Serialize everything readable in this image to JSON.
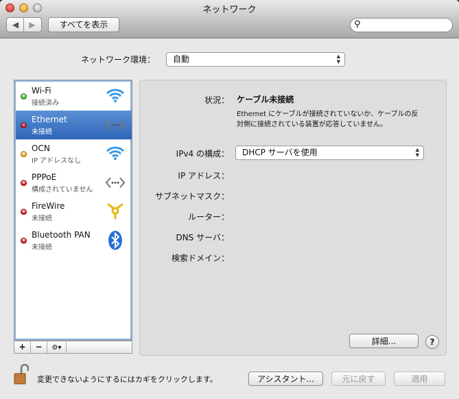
{
  "window": {
    "title": "ネットワーク"
  },
  "toolbar": {
    "show_all": "すべてを表示",
    "search_placeholder": ""
  },
  "location": {
    "label": "ネットワーク環境：",
    "value": "自動"
  },
  "services": [
    {
      "name": "Wi-Fi",
      "status": "接続済み",
      "color": "#3cb023",
      "icon": "wifi-icon"
    },
    {
      "name": "Ethernet",
      "status": "未接続",
      "color": "#c8161b",
      "icon": "ethernet-icon",
      "selected": true
    },
    {
      "name": "OCN",
      "status": "IP アドレスなし",
      "color": "#f0a010",
      "icon": "wifi-icon"
    },
    {
      "name": "PPPoE",
      "status": "構成されていません",
      "color": "#c8161b",
      "icon": "ethernet-icon"
    },
    {
      "name": "FireWire",
      "status": "未接続",
      "color": "#c8161b",
      "icon": "firewire-icon"
    },
    {
      "name": "Bluetooth PAN",
      "status": "未接続",
      "color": "#c8161b",
      "icon": "bluetooth-icon"
    }
  ],
  "list_bar": {
    "add": "+",
    "remove": "−",
    "gear": "⚙▾"
  },
  "detail": {
    "status_label": "状況：",
    "status_value": "ケーブル未接続",
    "status_desc_1": "Ethernet にケーブルが接続されていないか、ケーブルの反",
    "status_desc_2": "対側に接続されている装置が応答していません。",
    "ipv4_label": "IPv4 の構成：",
    "ipv4_value": "DHCP サーバを使用",
    "ip_label": "IP アドレス：",
    "subnet_label": "サブネットマスク：",
    "router_label": "ルーター：",
    "dns_label": "DNS サーバ：",
    "search_domain_label": "検索ドメイン：",
    "advanced": "詳細...",
    "help": "?"
  },
  "footer": {
    "lock_text": "変更できないようにするにはカギをクリックします。",
    "assistant": "アシスタント...",
    "revert": "元に戻す",
    "apply": "適用"
  }
}
